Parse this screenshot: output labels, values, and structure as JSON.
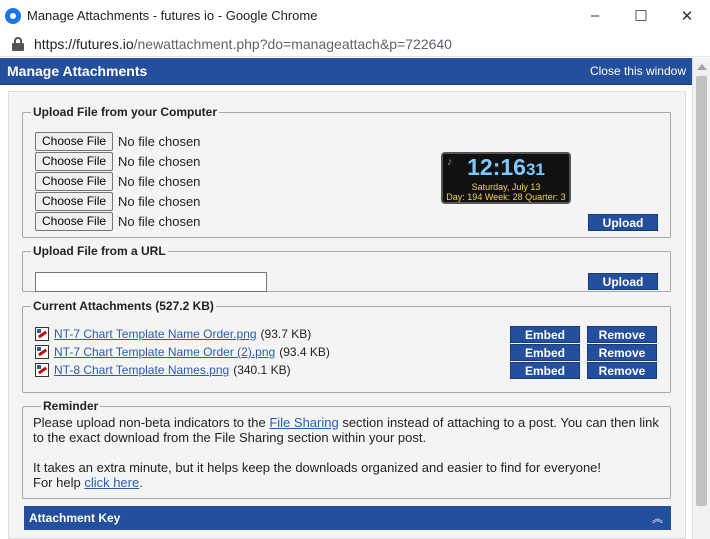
{
  "window": {
    "title": "Manage Attachments - futures io - Google Chrome",
    "minimize": "–",
    "maximize": "☐",
    "close": "✕"
  },
  "address": {
    "host": "https://futures.io",
    "path": "/newattachment.php?do=manageattach&p=722640"
  },
  "header": {
    "title": "Manage Attachments",
    "close_link": "Close this window"
  },
  "upload_computer": {
    "legend": "Upload File from your Computer",
    "rows": [
      {
        "button": "Choose File",
        "status": "No file chosen"
      },
      {
        "button": "Choose File",
        "status": "No file chosen"
      },
      {
        "button": "Choose File",
        "status": "No file chosen"
      },
      {
        "button": "Choose File",
        "status": "No file chosen"
      },
      {
        "button": "Choose File",
        "status": "No file chosen"
      }
    ],
    "upload_button": "Upload"
  },
  "clock": {
    "time_hm": "12:16",
    "time_s": "31",
    "date": "Saturday, July 13",
    "day_info": "Day: 194  Week: 28  Quarter: 3"
  },
  "upload_url": {
    "legend": "Upload File from a URL",
    "input_value": "",
    "upload_button": "Upload"
  },
  "attachments": {
    "legend": "Current Attachments (527.2 KB)",
    "embed_label": "Embed",
    "remove_label": "Remove",
    "items": [
      {
        "name": "NT-7 Chart Template Name Order.png",
        "size": "(93.7 KB)"
      },
      {
        "name": "NT-7 Chart Template Name Order (2).png",
        "size": "(93.4 KB)"
      },
      {
        "name": "NT-8 Chart Template Names.png",
        "size": "(340.1 KB)"
      }
    ]
  },
  "reminder": {
    "legend": "Reminder",
    "p1_before": "Please upload non-beta indicators to the ",
    "p1_link": "File Sharing",
    "p1_after": " section instead of attaching to a post. You can then link to the exact download from the File Sharing section within your post.",
    "p2": "It takes an extra minute, but it helps keep the downloads organized and easier to find for everyone!",
    "p3_before": "For help ",
    "p3_link": "click here",
    "p3_after": "."
  },
  "attachment_key": {
    "title": "Attachment Key",
    "collapse_icon": "︽"
  }
}
